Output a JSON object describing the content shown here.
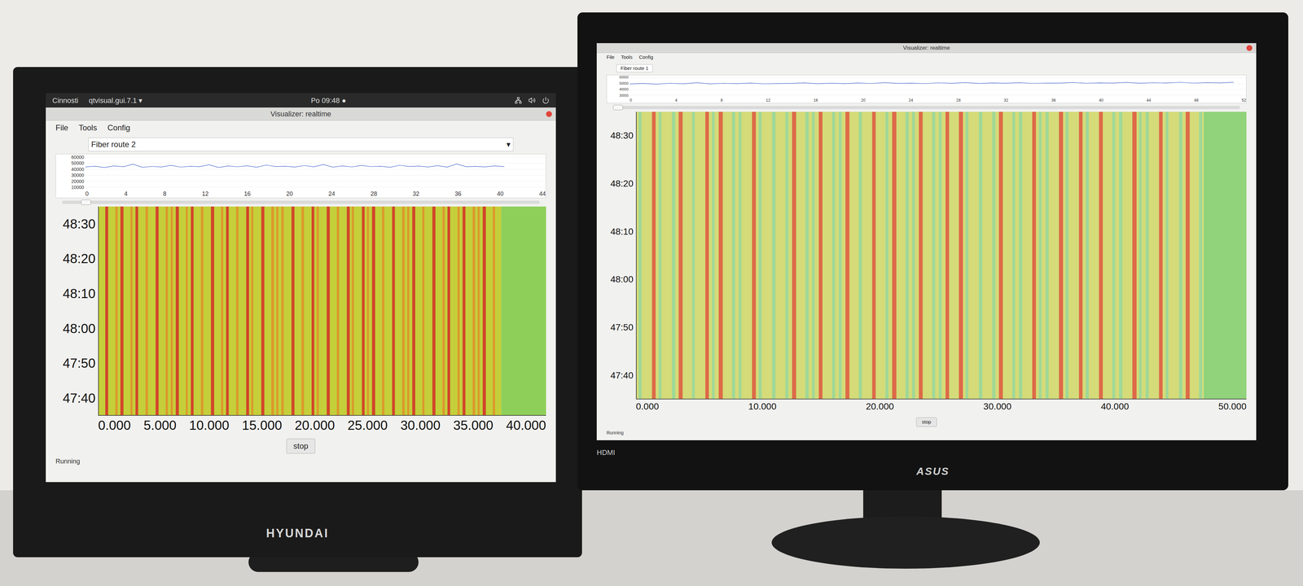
{
  "monitors": [
    {
      "brand": "HYUNDAI",
      "bezel_labels": [],
      "topbar": {
        "activities": "Cinnosti",
        "app": "qtvisual.gui.7.1 ▾",
        "clock": "Po 09:48 ●"
      },
      "window": {
        "title": "Visualizer: realtime",
        "menu": [
          "File",
          "Tools",
          "Config"
        ],
        "route": {
          "label": "Fiber route 2",
          "kind": "dropdown",
          "arrow": "▾"
        },
        "trace": {
          "y_ticks": [
            "60000",
            "50000",
            "40000",
            "30000",
            "20000",
            "10000"
          ],
          "y_max": 65000,
          "x_ticks": [
            "0",
            "4",
            "8",
            "12",
            "16",
            "20",
            "24",
            "28",
            "32",
            "36",
            "40",
            "44"
          ],
          "data_level": 0.91,
          "values": [
            42000,
            43500,
            41000,
            44000,
            42500,
            47000,
            41500,
            43000,
            42000,
            45000,
            41800,
            43200,
            42600,
            46000,
            41200,
            43800,
            42400,
            44200,
            41600,
            45500,
            42800,
            43400,
            41900,
            44600,
            42300,
            46500,
            41700,
            43900,
            42100,
            44800,
            42700,
            43300,
            41400,
            45200,
            42900,
            43600,
            42000,
            44400,
            41800,
            47500,
            42500,
            43100,
            42200,
            44000,
            42600
          ]
        },
        "slider": {
          "level": 0.04
        },
        "waterfall": {
          "y_ticks": [
            "48:30",
            "48:20",
            "48:10",
            "48:00",
            "47:50",
            "47:40"
          ],
          "x_ticks": [
            "0.000",
            "5.000",
            "10.000",
            "15.000",
            "20.000",
            "25.000",
            "30.000",
            "35.000",
            "40.000"
          ],
          "data_level": 0.9,
          "stripes": [
            0.3,
            0.8,
            0.2,
            0.5,
            0.9,
            0.1,
            0.4,
            0.7,
            0.2,
            0.6,
            0.3,
            0.85,
            0.15,
            0.5,
            0.4,
            0.9,
            0.2,
            0.35,
            0.75,
            0.1,
            0.6,
            0.3,
            0.95,
            0.2,
            0.45,
            0.7,
            0.25,
            0.55,
            0.1,
            0.8,
            0.4,
            0.3,
            0.9,
            0.2,
            0.65,
            0.35,
            0.5,
            0.15,
            0.85,
            0.3,
            0.6,
            0.2,
            0.7,
            0.45,
            0.1,
            0.9,
            0.3,
            0.55,
            0.25,
            0.8,
            0.4,
            0.15,
            0.7,
            0.35,
            0.95,
            0.2,
            0.5,
            0.3,
            0.75,
            0.1,
            0.6,
            0.4,
            0.85,
            0.2,
            0.45,
            0.3,
            0.9,
            0.15,
            0.55,
            0.7,
            0.25,
            0.4,
            0.8,
            0.2,
            0.6,
            0.35,
            0.95,
            0.1,
            0.5,
            0.3
          ]
        },
        "button": "stop",
        "status": "Running"
      }
    },
    {
      "brand": "ASUS",
      "bezel_labels": [
        "HDMI"
      ],
      "topbar": null,
      "window": {
        "title": "Visualizer: realtime",
        "menu": [
          "File",
          "Tools",
          "Config"
        ],
        "route": {
          "label": "Fiber route 1",
          "kind": "tab"
        },
        "trace": {
          "y_ticks": [
            "60000",
            "50000",
            "40000",
            "30000"
          ],
          "y_max": 65000,
          "x_ticks": [
            "0",
            "4",
            "8",
            "12",
            "16",
            "20",
            "24",
            "28",
            "32",
            "36",
            "40",
            "44",
            "48",
            "52"
          ],
          "data_level": 0.98,
          "values": [
            40000,
            41500,
            39500,
            42000,
            40500,
            43500,
            40200,
            41800,
            40900,
            42600,
            40400,
            41200,
            41700,
            43000,
            40800,
            42200,
            41000,
            42900,
            41300,
            43800,
            41600,
            42400,
            41100,
            43200,
            41900,
            44000,
            41400,
            42800,
            42100,
            43600,
            41800,
            42500,
            42300,
            44200,
            42000,
            43100,
            42600,
            44500,
            42200,
            43400,
            42800,
            44800,
            42500,
            43700,
            43000,
            45000
          ]
        },
        "slider": {
          "level": 0.0
        },
        "waterfall": {
          "y_ticks": [
            "48:30",
            "48:20",
            "48:10",
            "48:00",
            "47:50",
            "47:40"
          ],
          "x_ticks": [
            "0.000",
            "10.000",
            "20.000",
            "30.000",
            "40.000",
            "50.000"
          ],
          "data_level": 0.93,
          "stripes": [
            0.5,
            0.2,
            0.75,
            0.4,
            0.1,
            0.6,
            0.85,
            0.3,
            0.45,
            0.2,
            0.7,
            0.35,
            0.9,
            0.15,
            0.55,
            0.4,
            0.25,
            0.8,
            0.5,
            0.1,
            0.65,
            0.3,
            0.45,
            0.9,
            0.2,
            0.6,
            0.35,
            0.75,
            0.15,
            0.5,
            0.4,
            0.85,
            0.25,
            0.55,
            0.1,
            0.7,
            0.3,
            0.45,
            0.95,
            0.2,
            0.6,
            0.4,
            0.8,
            0.15,
            0.5,
            0.35,
            0.7,
            0.25,
            0.9,
            0.4,
            0.1,
            0.65,
            0.3,
            0.55,
            0.85,
            0.2,
            0.45,
            0.6,
            0.15,
            0.75,
            0.35,
            0.5,
            0.25,
            0.9,
            0.4,
            0.2,
            0.7,
            0.55,
            0.1,
            0.8,
            0.3,
            0.45,
            0.65,
            0.2,
            0.95,
            0.35,
            0.5,
            0.25,
            0.7,
            0.4,
            0.15,
            0.6,
            0.85,
            0.3,
            0.5
          ]
        },
        "button": "stop",
        "status": "Running"
      }
    }
  ]
}
